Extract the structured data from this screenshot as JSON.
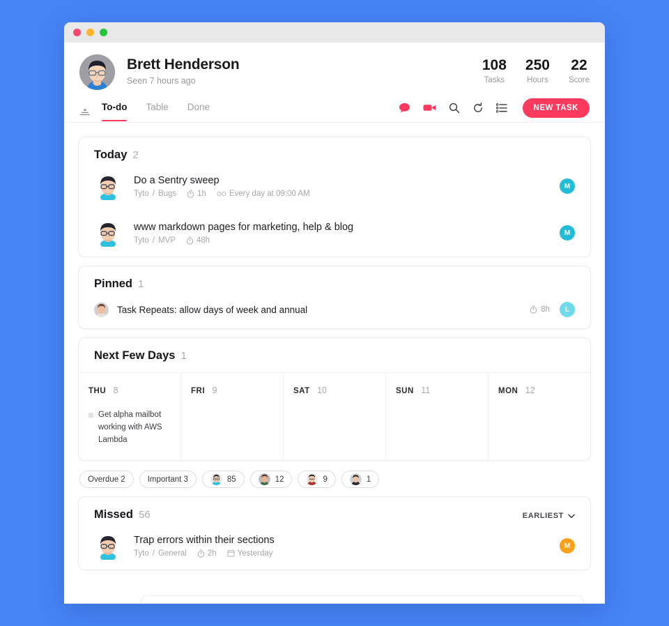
{
  "window": {
    "controls": [
      "close",
      "minimize",
      "zoom"
    ]
  },
  "header": {
    "name": "Brett Henderson",
    "seen": "Seen 7 hours ago",
    "stats": [
      {
        "value": "108",
        "label": "Tasks"
      },
      {
        "value": "250",
        "label": "Hours"
      },
      {
        "value": "22",
        "label": "Score"
      }
    ]
  },
  "tabs": {
    "filter_icon": "sort-filter-icon",
    "items": [
      {
        "label": "To-do",
        "active": true
      },
      {
        "label": "Table",
        "active": false
      },
      {
        "label": "Done",
        "active": false
      }
    ],
    "toolbar": [
      {
        "icon": "chat-bubble-icon"
      },
      {
        "icon": "video-camera-icon"
      },
      {
        "icon": "search-icon"
      },
      {
        "icon": "refresh-icon"
      },
      {
        "icon": "list-icon"
      }
    ],
    "new_task_label": "NEW TASK"
  },
  "today": {
    "title": "Today",
    "count": "2",
    "tasks": [
      {
        "title": "Do a Sentry sweep",
        "project": "Tyto",
        "category": "Bugs",
        "duration": "1h",
        "repeat": "Every day at 09:00 AM",
        "badge": "M",
        "badge_color": "#22bcd9"
      },
      {
        "title": "www markdown pages for marketing, help & blog",
        "project": "Tyto",
        "category": "MVP",
        "duration": "48h",
        "repeat": "",
        "badge": "M",
        "badge_color": "#22bcd9"
      }
    ]
  },
  "pinned": {
    "title": "Pinned",
    "count": "1",
    "tasks": [
      {
        "title": "Task Repeats: allow days of week and annual",
        "duration": "8h",
        "badge": "L",
        "badge_color": "#6fdbea"
      }
    ]
  },
  "next_few_days": {
    "title": "Next Few Days",
    "count": "1",
    "days": [
      {
        "dow": "THU",
        "num": "8",
        "tasks": [
          "Get alpha mailbot working with AWS Lambda"
        ]
      },
      {
        "dow": "FRI",
        "num": "9",
        "tasks": []
      },
      {
        "dow": "SAT",
        "num": "10",
        "tasks": []
      },
      {
        "dow": "SUN",
        "num": "11",
        "tasks": []
      },
      {
        "dow": "MON",
        "num": "12",
        "tasks": []
      }
    ]
  },
  "chips": [
    {
      "label": "Overdue 2",
      "avatar": false
    },
    {
      "label": "Important 3",
      "avatar": false
    },
    {
      "label": "85",
      "avatar": true,
      "avatar_name": "person-avatar-1"
    },
    {
      "label": "12",
      "avatar": true,
      "avatar_name": "person-avatar-2"
    },
    {
      "label": "9",
      "avatar": true,
      "avatar_name": "person-avatar-3"
    },
    {
      "label": "1",
      "avatar": true,
      "avatar_name": "person-avatar-4"
    }
  ],
  "missed": {
    "title": "Missed",
    "count": "56",
    "sort_label": "EARLIEST",
    "tasks": [
      {
        "title": "Trap errors within their sections",
        "project": "Tyto",
        "category": "General",
        "duration": "2h",
        "date": "Yesterday",
        "badge": "M",
        "badge_color": "#fba018"
      }
    ]
  },
  "colors": {
    "accent": "#fb3a5d",
    "background": "#4583f7"
  }
}
